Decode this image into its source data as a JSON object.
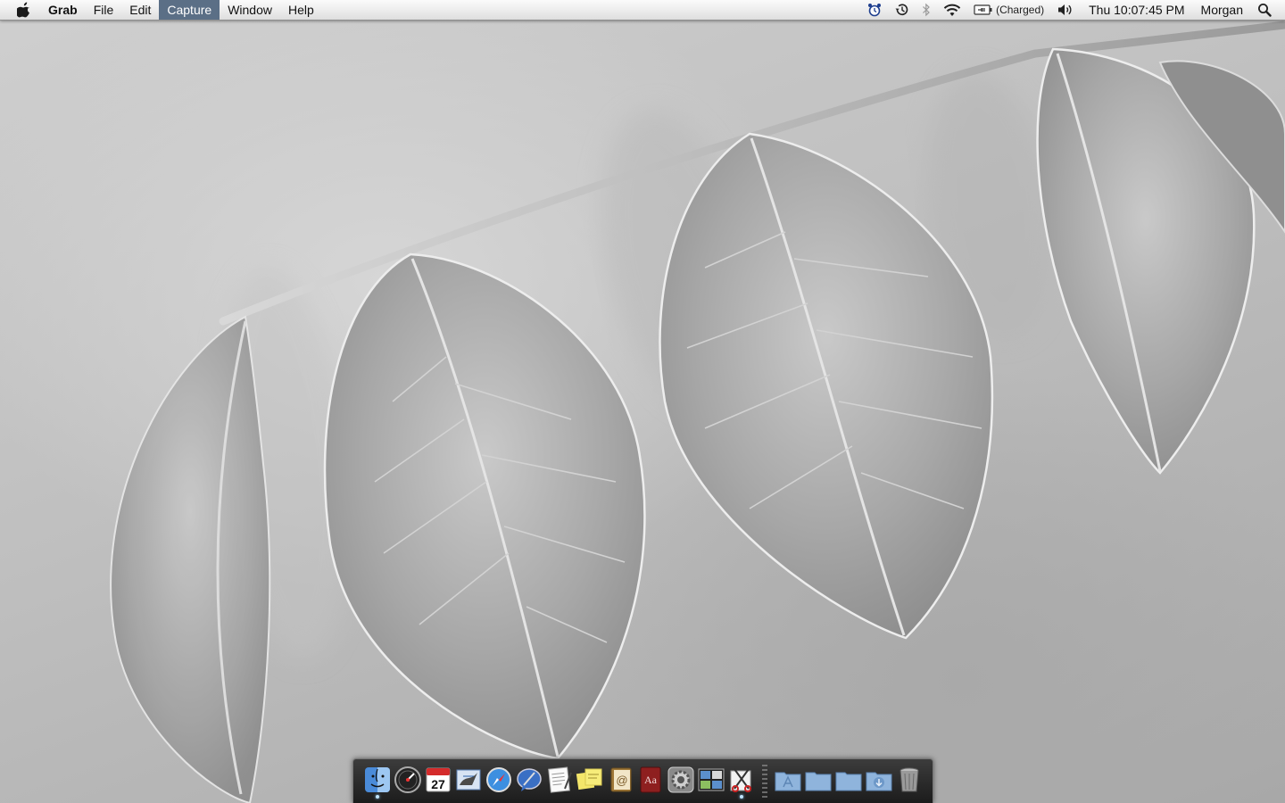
{
  "menubar": {
    "apple_icon": "apple-logo-icon",
    "app_name": "Grab",
    "menus": [
      {
        "label": "File"
      },
      {
        "label": "Edit"
      },
      {
        "label": "Capture",
        "active": true
      },
      {
        "label": "Window"
      },
      {
        "label": "Help"
      }
    ],
    "status": {
      "battery_status": "(Charged)",
      "clock": "Thu 10:07:45 PM",
      "user": "Morgan"
    },
    "active_color": "#5b6f86"
  },
  "dock": {
    "apps": [
      {
        "name": "finder-icon",
        "running": true
      },
      {
        "name": "dashboard-icon",
        "running": false
      },
      {
        "name": "ical-icon",
        "date_text": "27",
        "running": false
      },
      {
        "name": "mail-icon",
        "running": false
      },
      {
        "name": "safari-icon",
        "running": false
      },
      {
        "name": "ichat-icon",
        "running": false
      },
      {
        "name": "textedit-icon",
        "running": false
      },
      {
        "name": "stickies-icon",
        "running": false
      },
      {
        "name": "address-book-icon",
        "running": false
      },
      {
        "name": "dictionary-icon",
        "glyph": "Aa",
        "running": false
      },
      {
        "name": "system-preferences-icon",
        "running": false
      },
      {
        "name": "spaces-icon",
        "running": false
      },
      {
        "name": "grab-icon",
        "running": true
      }
    ],
    "stacks": [
      {
        "name": "applications-folder-icon"
      },
      {
        "name": "documents-folder-icon"
      },
      {
        "name": "stack-folder-icon"
      },
      {
        "name": "downloads-folder-icon"
      },
      {
        "name": "trash-icon"
      }
    ]
  }
}
